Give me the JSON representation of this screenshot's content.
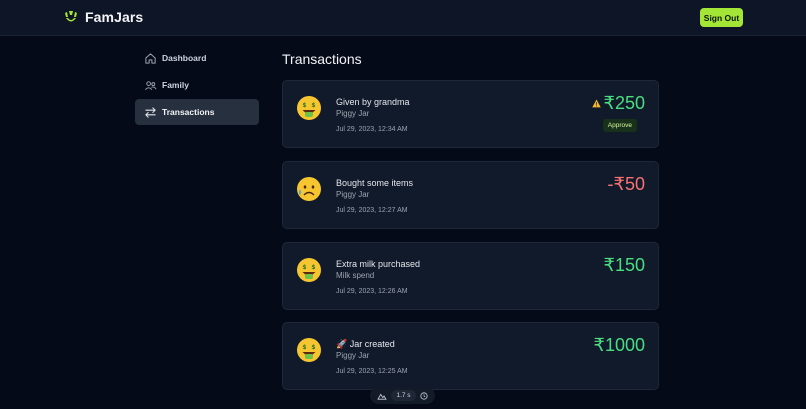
{
  "header": {
    "brand": "FamJars",
    "sign_out_label": "Sign Out"
  },
  "sidebar": {
    "items": [
      {
        "label": "Dashboard",
        "icon": "home-icon",
        "active": false
      },
      {
        "label": "Family",
        "icon": "users-icon",
        "active": false
      },
      {
        "label": "Transactions",
        "icon": "arrows-exchange-icon",
        "active": true
      }
    ]
  },
  "main": {
    "title": "Transactions",
    "transactions": [
      {
        "emoji": "money-mouth-face",
        "title": "Given by grandma",
        "jar": "Piggy Jar",
        "date": "Jul 29, 2023, 12:34 AM",
        "amount": "₹250",
        "warning": true,
        "approve_label": "Approve"
      },
      {
        "emoji": "sad-face-with-sweat",
        "title": "Bought some items",
        "jar": "Piggy Jar",
        "date": "Jul 29, 2023, 12:27 AM",
        "amount": "-₹50"
      },
      {
        "emoji": "money-mouth-face",
        "title": "Extra milk purchased",
        "jar": "Milk spend",
        "date": "Jul 29, 2023, 12:26 AM",
        "amount": "₹150"
      },
      {
        "emoji": "money-mouth-face",
        "title": "🚀 Jar created",
        "jar": "Piggy Jar",
        "date": "Jul 29, 2023, 12:25 AM",
        "amount": "₹1000"
      }
    ]
  },
  "devtools": {
    "zoom": "1.7 s"
  },
  "colors": {
    "accent": "#a3e635",
    "positive": "#4ade80",
    "negative": "#f87171",
    "background": "#050a18"
  }
}
